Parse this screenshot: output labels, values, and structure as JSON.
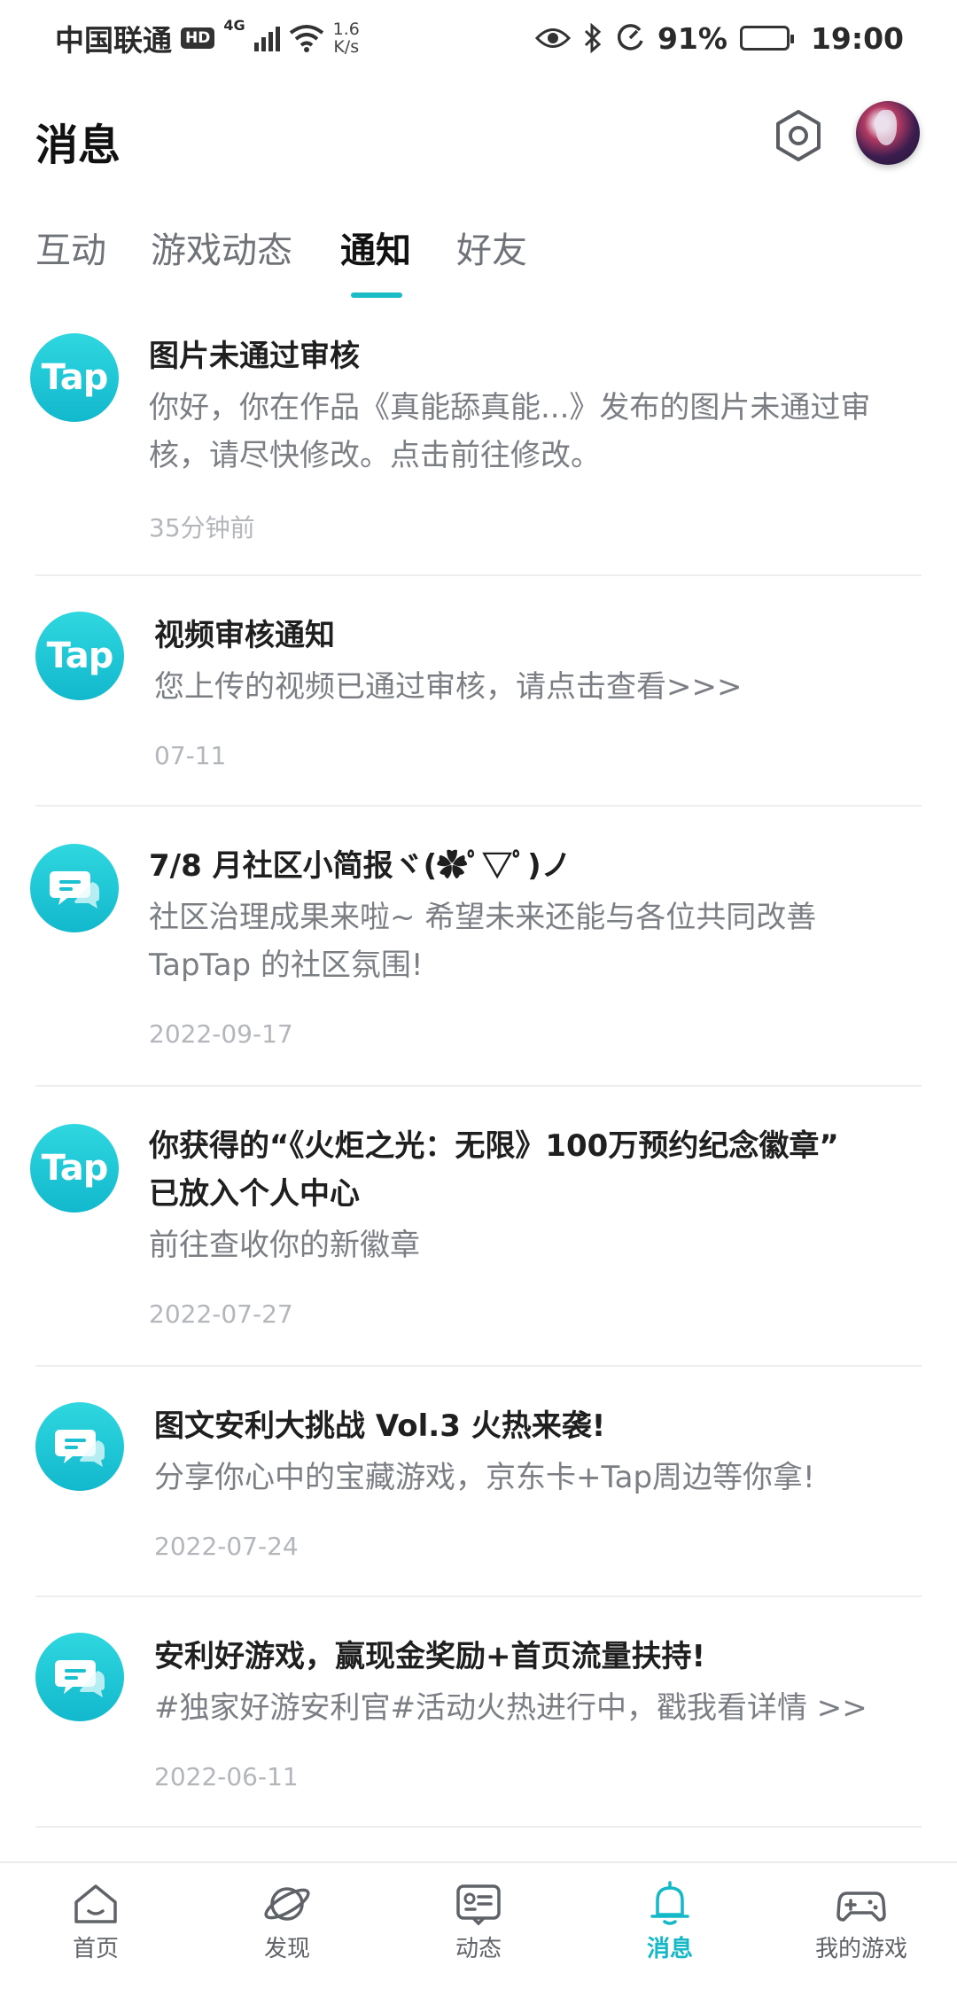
{
  "status_bar": {
    "carrier": "中国联通",
    "hd": "HD",
    "network": "4G",
    "speed_value": "1.6",
    "speed_unit": "K/s",
    "battery": "91%",
    "battery_level": 0.91,
    "time": "19:00",
    "icons": [
      "eye-icon",
      "bluetooth-icon",
      "data-saver-icon",
      "battery-icon"
    ]
  },
  "header": {
    "title": "消息",
    "settings_icon": "settings-hexagon-icon",
    "avatar_icon": "avatar"
  },
  "tabs": [
    {
      "label": "互动",
      "active": false
    },
    {
      "label": "游戏动态",
      "active": false
    },
    {
      "label": "通知",
      "active": true
    },
    {
      "label": "好友",
      "active": false
    }
  ],
  "notifications": [
    {
      "icon_type": "tap",
      "icon_text": "Tap",
      "title": "图片未通过审核",
      "body_lines": [
        "你好，你在作品《真能舔真能...》发布的图片未通过审",
        "核，请尽快修改。点击前往修改。"
      ],
      "time": "35分钟前"
    },
    {
      "icon_type": "tap",
      "icon_text": "Tap",
      "title": "视频审核通知",
      "body_lines": [
        "您上传的视频已通过审核，请点击查看>>>"
      ],
      "time": "07-11"
    },
    {
      "icon_type": "chat",
      "icon_text": "",
      "title": "7/8 月社区小简报ヾ(✿ﾟ▽ﾟ)ノ",
      "body_lines": [
        "社区治理成果来啦~ 希望未来还能与各位共同改善",
        "TapTap 的社区氛围!"
      ],
      "time": "2022-09-17"
    },
    {
      "icon_type": "tap",
      "icon_text": "Tap",
      "title_lines": [
        "你获得的“《火炬之光：无限》100万预约纪念徽章”",
        "已放入个人中心"
      ],
      "body_lines": [
        "前往查收你的新徽章"
      ],
      "time": "2022-07-27"
    },
    {
      "icon_type": "chat",
      "icon_text": "",
      "title": "图文安利大挑战 Vol.3 火热来袭!",
      "body_lines": [
        "分享你心中的宝藏游戏，京东卡+Tap周边等你拿!"
      ],
      "time": "2022-07-24"
    },
    {
      "icon_type": "chat",
      "icon_text": "",
      "title": "安利好游戏，赢现金奖励+首页流量扶持!",
      "body_lines": [
        "#独家好游安利官#活动火热进行中，戳我看详情 >>"
      ],
      "time": "2022-06-11"
    }
  ],
  "bottom_nav": [
    {
      "label": "首页",
      "icon": "home-icon",
      "active": false
    },
    {
      "label": "发现",
      "icon": "discover-planet-icon",
      "active": false
    },
    {
      "label": "动态",
      "icon": "feed-card-icon",
      "active": false
    },
    {
      "label": "消息",
      "icon": "bell-icon",
      "active": true
    },
    {
      "label": "我的游戏",
      "icon": "gamepad-icon",
      "active": false
    }
  ],
  "colors": {
    "accent": "#19bcc7",
    "text_primary": "#1f1f1f",
    "text_secondary": "#7b7f84",
    "text_time": "#b3b6ba"
  }
}
